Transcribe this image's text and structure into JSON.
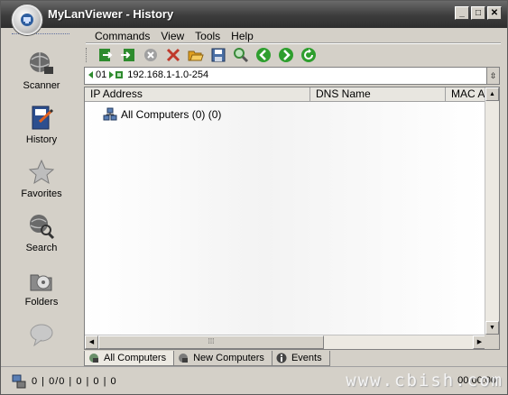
{
  "window": {
    "title": "MyLanViewer - History",
    "buttons": {
      "minimize": "_",
      "maximize": "□",
      "close": "✕"
    }
  },
  "sidebar": {
    "items": [
      {
        "label": "Scanner",
        "icon": "scanner-globe-icon"
      },
      {
        "label": "History",
        "icon": "history-book-icon"
      },
      {
        "label": "Favorites",
        "icon": "star-icon"
      },
      {
        "label": "Search",
        "icon": "search-globe-icon"
      },
      {
        "label": "Folders",
        "icon": "folders-icon"
      },
      {
        "label": "",
        "icon": "chat-bubble-icon"
      }
    ]
  },
  "menu": {
    "items": [
      "Commands",
      "View",
      "Tools",
      "Help"
    ]
  },
  "toolbar": {
    "buttons": [
      {
        "icon": "export-green-icon",
        "color": "#2e8b2e"
      },
      {
        "icon": "import-green-icon",
        "color": "#2e8b2e"
      },
      {
        "icon": "cancel-circle-icon",
        "color": "#9a9a9a"
      },
      {
        "icon": "delete-x-icon",
        "color": "#c0392b"
      },
      {
        "icon": "open-folder-icon",
        "color": "#e0a020"
      },
      {
        "icon": "save-disk-icon",
        "color": "#4a6fa5"
      },
      {
        "icon": "find-magnifier-icon",
        "color": "#3a8a3a"
      },
      {
        "icon": "back-arrow-icon",
        "color": "#2e9e2e"
      },
      {
        "icon": "forward-arrow-icon",
        "color": "#2e9e2e"
      },
      {
        "icon": "refresh-icon",
        "color": "#2e9e2e"
      }
    ]
  },
  "address": {
    "index": "01",
    "range": "192.168.1-1.0-254"
  },
  "list": {
    "columns": [
      "IP Address",
      "DNS Name",
      "MAC A"
    ],
    "rows": [
      {
        "label": "All Computers (0) (0)",
        "icon": "network-computers-icon"
      }
    ]
  },
  "tabs": [
    {
      "label": "All Computers",
      "icon": "all-computers-icon",
      "active": true
    },
    {
      "label": "New Computers",
      "icon": "new-computers-icon",
      "active": false
    },
    {
      "label": "Events",
      "icon": "events-info-icon",
      "active": false
    }
  ],
  "status": {
    "counts": "0 | 0/0 | 0 | 0 | 0",
    "time": "00:00:00"
  },
  "watermark": "www.cbish.com"
}
